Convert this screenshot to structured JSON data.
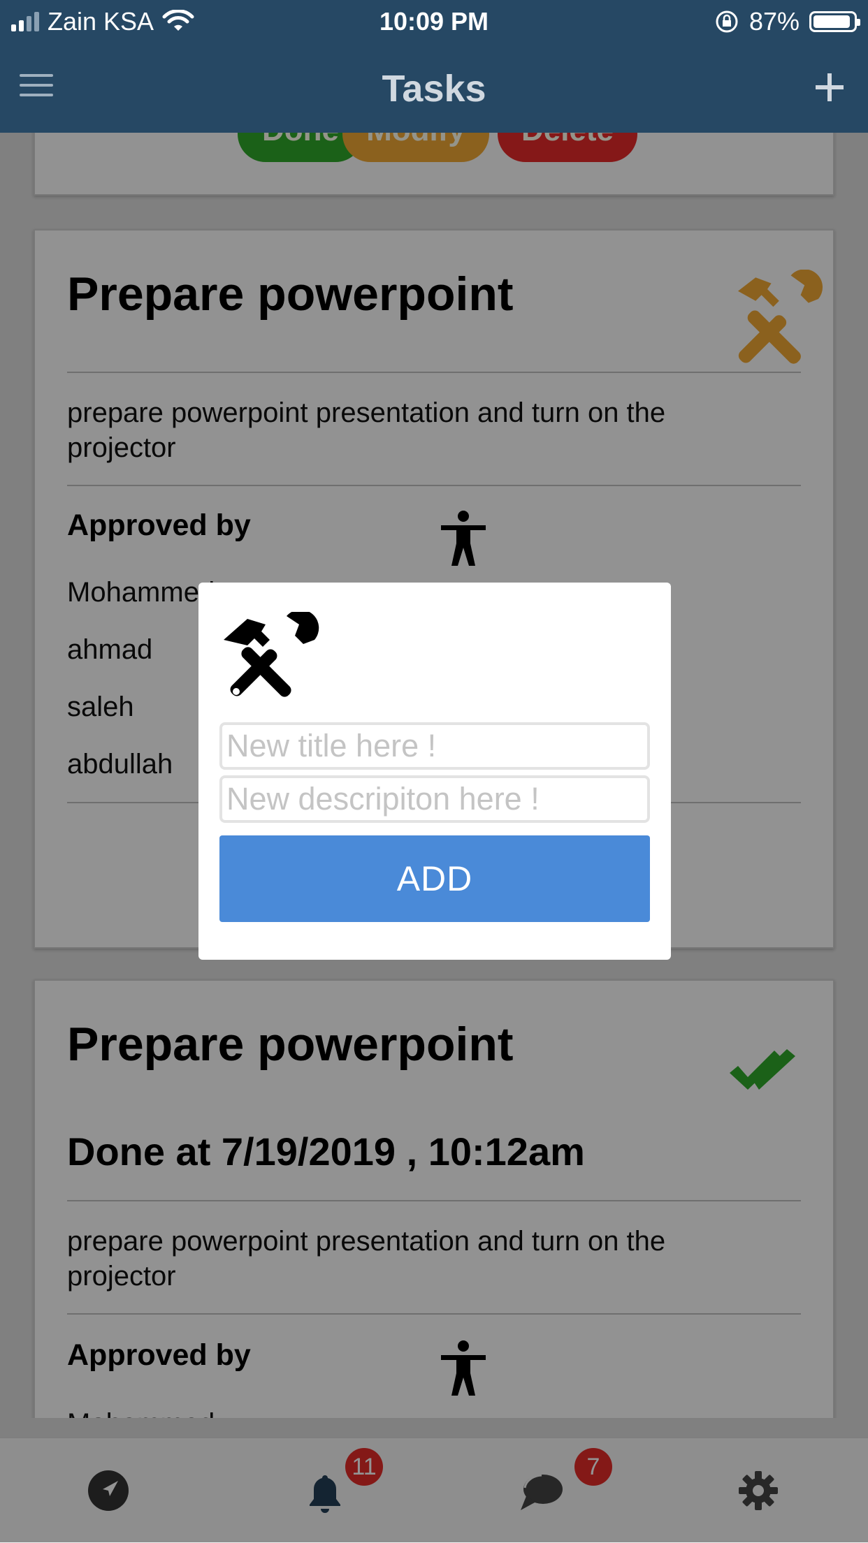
{
  "status_bar": {
    "carrier": "Zain KSA",
    "time": "10:09 PM",
    "battery": "87%",
    "battery_level": 0.87
  },
  "header": {
    "title": "Tasks",
    "menu_icon": "hamburger-icon",
    "add_icon": "plus-icon"
  },
  "cards": [
    {
      "title": "Prepare powerpoint",
      "status_icon": "tools-icon",
      "description": "prepare powerpoint presentation and turn on the projector",
      "approved_label": "Approved by",
      "approvers": [
        "Mohammed",
        "ahmad",
        "saleh",
        "abdullah"
      ],
      "actions": [
        "Done",
        "Modify",
        "Delete"
      ]
    },
    {
      "title": "Prepare powerpoint",
      "status_icon": "double-check-icon",
      "done_at": "Done at 7/19/2019 , 10:12am",
      "description": "prepare powerpoint presentation and turn on the projector",
      "approved_label": "Approved by",
      "approvers": [
        "Mohammed"
      ]
    }
  ],
  "modal": {
    "icon": "tools-icon",
    "title_placeholder": "New title here !",
    "description_placeholder": "New descripiton here !",
    "add_label": "ADD"
  },
  "tabbar": {
    "tabs": [
      {
        "icon": "location-arrow-icon"
      },
      {
        "icon": "bell-icon",
        "badge": "11"
      },
      {
        "icon": "chat-icon",
        "badge": "7"
      },
      {
        "icon": "gear-icon"
      }
    ]
  },
  "colors": {
    "header_bg": "#264864",
    "tools_orange": "#f0a835",
    "done_green": "#2fa72a",
    "delete_red": "#e52a2a",
    "add_button_blue": "#4a8ad8",
    "badge_red": "#e42b28"
  }
}
